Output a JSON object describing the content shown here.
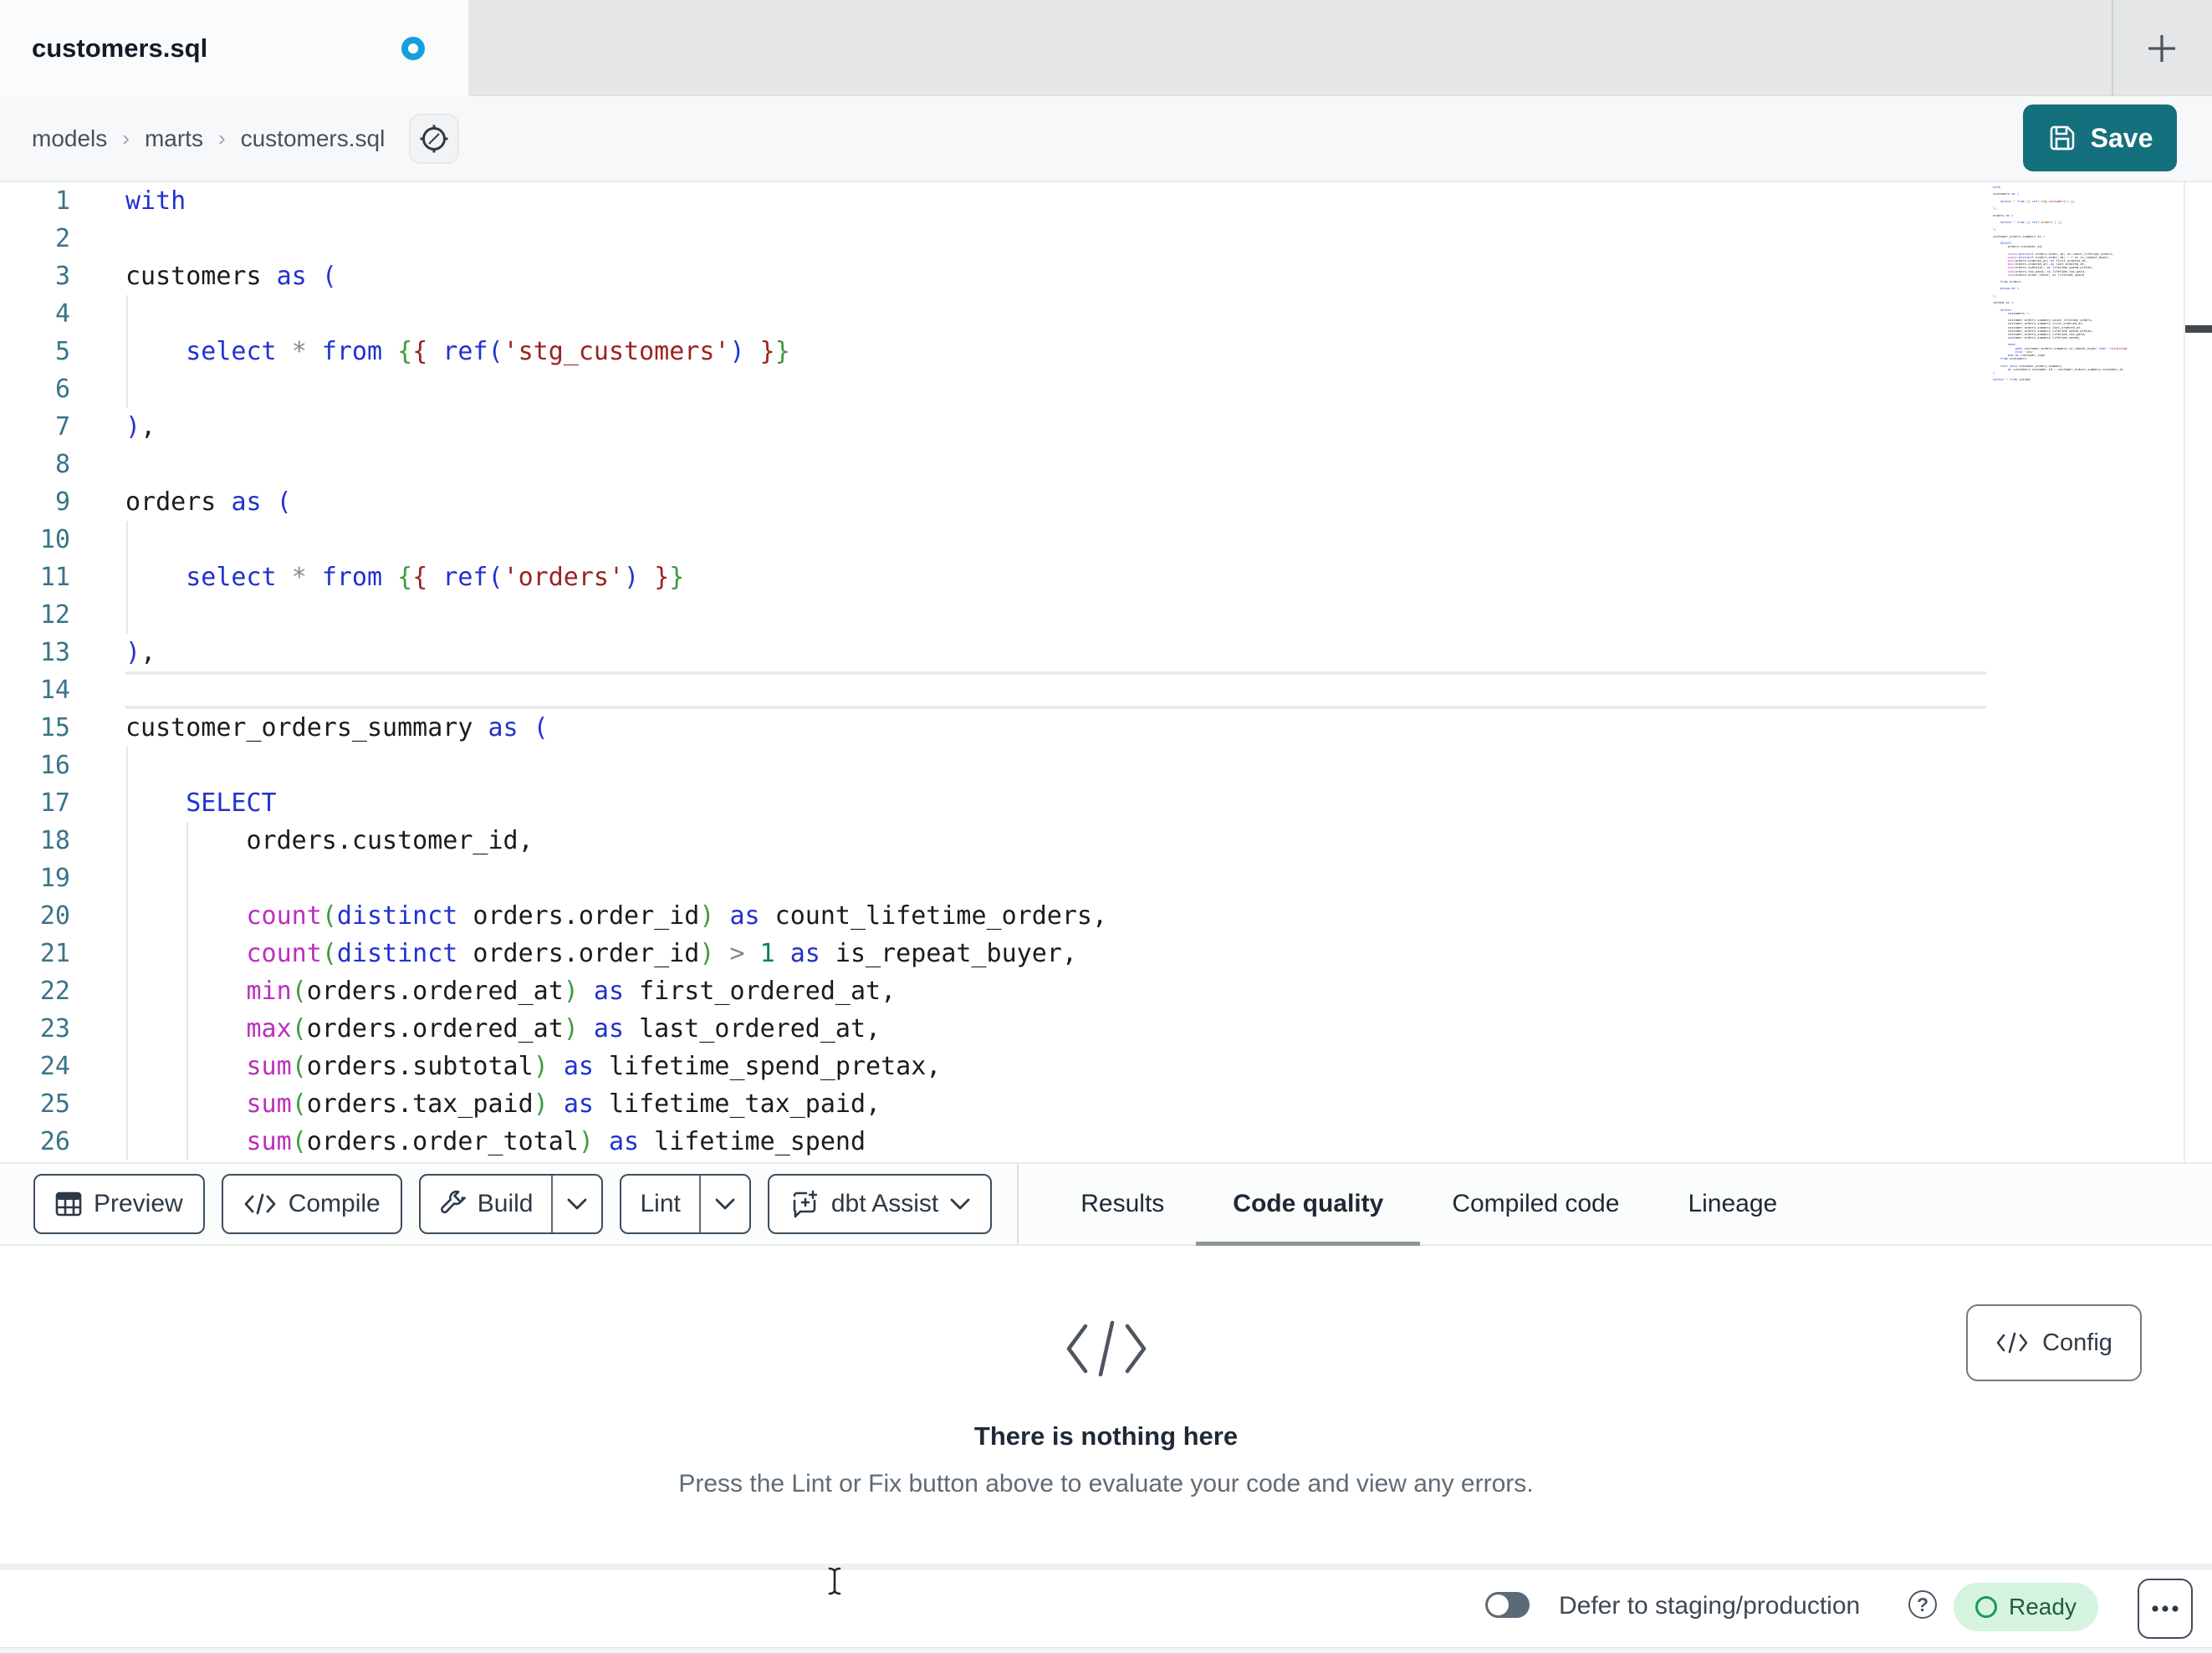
{
  "colors": {
    "accent_teal": "#14707c",
    "tab_dot_blue": "#149fdc",
    "keyword_blue": "#2132cf",
    "function_magenta": "#bc2fbe",
    "string_maroon": "#9b2320",
    "jinja_green": "#3e9a3e",
    "number_teal": "#0c8064",
    "line_number_teal": "#3a7488",
    "ready_bg_green": "#d5f4df",
    "ready_text_green": "#215c40"
  },
  "icons": {
    "tab_modified": "blue-dot",
    "new_tab": "plus",
    "breadcrumb_action": "compass",
    "save": "floppy-disk",
    "preview": "table-grid",
    "compile": "code-brackets",
    "build": "wrench",
    "build_more": "chevron-down",
    "lint_more": "chevron-down",
    "assist": "chat-bubble-plus",
    "assist_more": "chevron-down",
    "empty_state": "code-brackets",
    "config": "code-brackets",
    "help": "question-circle",
    "ready_status": "circle-outline",
    "more": "ellipsis",
    "mouse_pointer": "i-beam-cursor"
  },
  "tab_bar": {
    "title": "customers.sql",
    "modified": true
  },
  "breadcrumb": {
    "items": [
      "models",
      "marts",
      "customers.sql"
    ],
    "separator": "›"
  },
  "header": {
    "save_label": "Save"
  },
  "editor": {
    "active_line": 14,
    "lines": [
      "with",
      "",
      "customers as (",
      "",
      "    select * from {{ ref('stg_customers') }}",
      "",
      "),",
      "",
      "orders as (",
      "",
      "    select * from {{ ref('orders') }}",
      "",
      "),",
      "",
      "customer_orders_summary as (",
      "",
      "    SELECT",
      "        orders.customer_id,",
      "",
      "        count(distinct orders.order_id) as count_lifetime_orders,",
      "        count(distinct orders.order_id) > 1 as is_repeat_buyer,",
      "        min(orders.ordered_at) as first_ordered_at,",
      "        max(orders.ordered_at) as last_ordered_at,",
      "        sum(orders.subtotal) as lifetime_spend_pretax,",
      "        sum(orders.tax_paid) as lifetime_tax_paid,",
      "        sum(orders.order_total) as lifetime_spend"
    ],
    "guides": [
      [],
      [],
      [],
      [
        0
      ],
      [
        0
      ],
      [
        0
      ],
      [],
      [],
      [],
      [
        0
      ],
      [
        0
      ],
      [
        0
      ],
      [],
      [],
      [],
      [
        0
      ],
      [
        0
      ],
      [
        0,
        4
      ],
      [
        0,
        4
      ],
      [
        0,
        4
      ],
      [
        0,
        4
      ],
      [
        0,
        4
      ],
      [
        0,
        4
      ],
      [
        0,
        4
      ],
      [
        0,
        4
      ],
      [
        0,
        4
      ]
    ],
    "minimap_lines": [
      "with",
      "",
      "customers as (",
      "",
      "    select * from {{ ref('stg_customers') }}",
      "",
      "),",
      "",
      "orders as (",
      "",
      "    select * from {{ ref('orders') }}",
      "",
      "),",
      "",
      "customer_orders_summary as (",
      "",
      "    SELECT",
      "        orders.customer_id,",
      "",
      "        count(distinct orders.order_id) as count_lifetime_orders,",
      "        count(distinct orders.order_id) > 1 as is_repeat_buyer,",
      "        min(orders.ordered_at) as first_ordered_at,",
      "        max(orders.ordered_at) as last_ordered_at,",
      "        sum(orders.subtotal) as lifetime_spend_pretax,",
      "        sum(orders.tax_paid) as lifetime_tax_paid,",
      "        sum(orders.order_total) as lifetime_spend",
      "",
      "    from orders",
      "",
      "    group by 1",
      "",
      "),",
      "",
      "joined as (",
      "",
      "    select",
      "        customers.*,",
      "",
      "        customer_orders_summary.count_lifetime_orders,",
      "        customer_orders_summary.first_ordered_at,",
      "        customer_orders_summary.last_ordered_at,",
      "        customer_orders_summary.lifetime_spend_pretax,",
      "        customer_orders_summary.lifetime_tax_paid,",
      "        customer_orders_summary.lifetime_spend,",
      "",
      "        case",
      "            when customer_orders_summary.is_repeat_buyer then 'returning'",
      "            else 'new'",
      "        end as customer_type",
      "    from customers",
      "",
      "    left join customer_orders_summary",
      "        on customers.customer_id = customer_orders_summary.customer_id",
      ")",
      "",
      "select * from joined"
    ]
  },
  "toolbar": {
    "preview_label": "Preview",
    "compile_label": "Compile",
    "build_label": "Build",
    "lint_label": "Lint",
    "assist_label": "dbt Assist"
  },
  "result_tabs": [
    {
      "label": "Results",
      "active": false
    },
    {
      "label": "Code quality",
      "active": true
    },
    {
      "label": "Compiled code",
      "active": false
    },
    {
      "label": "Lineage",
      "active": false
    }
  ],
  "empty_state": {
    "title": "There is nothing here",
    "message": "Press the Lint or Fix button above to evaluate your code and view any errors.",
    "config_label": "Config"
  },
  "status_bar": {
    "defer_label": "Defer to staging/production",
    "ready_label": "Ready",
    "defer_toggle_on": false
  }
}
